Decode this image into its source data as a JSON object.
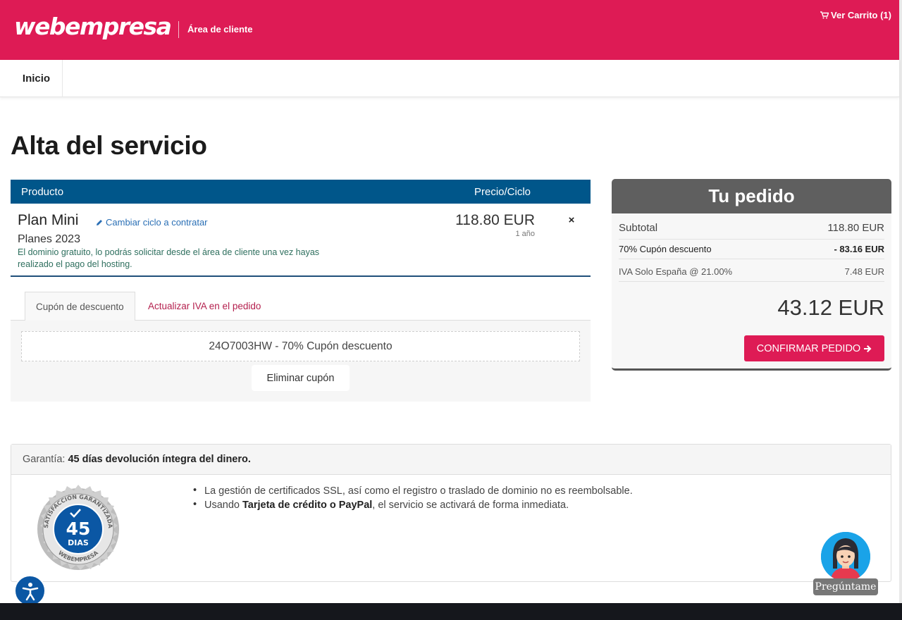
{
  "header": {
    "logo_text": "webempresa",
    "area_label": "Área de cliente",
    "cart_label": "Ver Carrito (1)"
  },
  "nav": {
    "home": "Inicio"
  },
  "page": {
    "title": "Alta del servicio"
  },
  "product_table": {
    "col_product": "Producto",
    "col_price": "Precio/Ciclo",
    "product_name": "Plan Mini",
    "change_cycle_label": "Cambiar ciclo a contratar",
    "product_group": "Planes 2023",
    "note": "El dominio gratuito, lo podrás solicitar desde el área de cliente una vez hayas realizado el pago del hosting.",
    "price": "118.80 EUR",
    "cycle": "1 año",
    "remove_symbol": "×"
  },
  "coupon": {
    "tab_coupon": "Cupón de descuento",
    "tab_vat": "Actualizar IVA en el pedido",
    "applied": "24O7003HW - 70% Cupón descuento",
    "remove_label": "Eliminar cupón"
  },
  "order": {
    "title": "Tu pedido",
    "subtotal_label": "Subtotal",
    "subtotal_value": "118.80 EUR",
    "discount_label": "70% Cupón descuento",
    "discount_value": "- 83.16 EUR",
    "tax_label": "IVA Solo España @ 21.00%",
    "tax_value": "7.48 EUR",
    "total": "43.12 EUR",
    "confirm_label": "CONFIRMAR PEDIDO"
  },
  "guarantee": {
    "label": "Garantía:",
    "highlight": "45 días devolución íntegra del dinero.",
    "badge_top": "SATISFACCIÓN GARANTIZADA",
    "badge_number": "45",
    "badge_unit": "DIAS",
    "badge_bottom": "WEBEMPRESA",
    "bullet1": "La gestión de certificados SSL, así como el registro o traslado de dominio no es reembolsable.",
    "bullet2_prefix": "Usando ",
    "bullet2_bold": "Tarjeta de crédito o PayPal",
    "bullet2_suffix": ", el servicio se activará de forma inmediata."
  },
  "assistant": {
    "label": "Pregúntame"
  },
  "colors": {
    "brand": "#de1b55",
    "table_header": "#00568a",
    "order_header": "#5f5f5f"
  }
}
